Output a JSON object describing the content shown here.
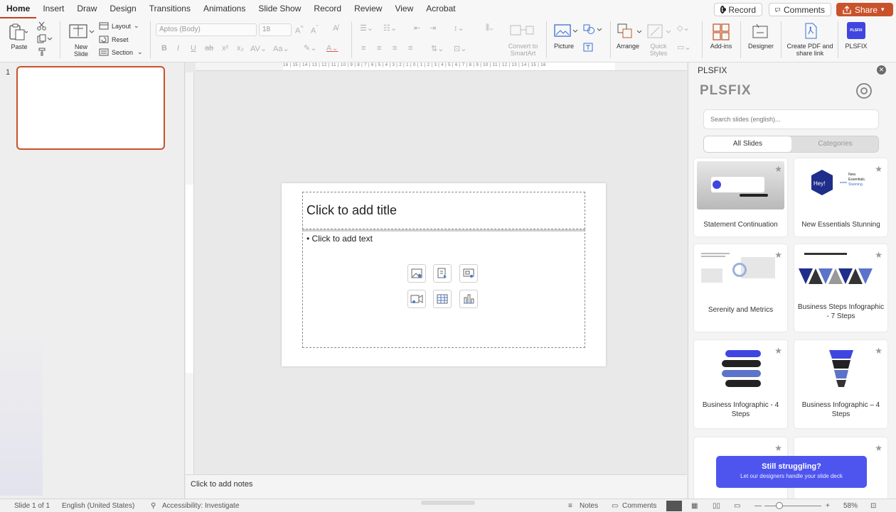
{
  "tabs": [
    "Home",
    "Insert",
    "Draw",
    "Design",
    "Transitions",
    "Animations",
    "Slide Show",
    "Record",
    "Review",
    "View",
    "Acrobat"
  ],
  "active_tab": "Home",
  "top_buttons": {
    "record": "Record",
    "comments": "Comments",
    "share": "Share"
  },
  "ribbon": {
    "paste": "Paste",
    "new_slide": "New Slide",
    "layout": "Layout",
    "reset": "Reset",
    "section": "Section",
    "font_name": "Aptos (Body)",
    "font_size": "18",
    "convert_smartart": "Convert to SmartArt",
    "picture": "Picture",
    "arrange": "Arrange",
    "quick_styles": "Quick Styles",
    "addins": "Add-ins",
    "designer": "Designer",
    "create_pdf": "Create PDF and share link",
    "plsfix": "PLSFIX",
    "plsfix_badge": "PLSFIX"
  },
  "thumbs": {
    "slide_number": "1"
  },
  "ruler": {
    "marks": "16 | 15 | 14 | 13 | 12 | 11 | 10 | 9 | 8 | 7 | 6 | 5 | 4 | 3 | 2 | 1 | 0 | 1 | 2 | 3 | 4 | 5 | 6 | 7 | 8 | 9 | 10 | 11 | 12 | 13 | 14 | 15 | 16"
  },
  "slide": {
    "title_placeholder": "Click to add title",
    "body_placeholder": "• Click to add text"
  },
  "notes": {
    "placeholder": "Click to add notes"
  },
  "pane": {
    "title": "PLSFIX",
    "logo": "PLSFIX",
    "search_placeholder": "Search slides (english)...",
    "segments": [
      "All Slides",
      "Categories"
    ],
    "cards": [
      {
        "label": "Statement Continuation"
      },
      {
        "label": "New Essentials Stunning"
      },
      {
        "label": "Serenity and Metrics"
      },
      {
        "label": "Business Steps Infographic - 7 Steps"
      },
      {
        "label": "Business Infographic - 4 Steps"
      },
      {
        "label": "Business Infographic – 4 Steps"
      }
    ],
    "cta_title": "Still struggling?",
    "cta_subtitle": "Let our designers handle your slide deck"
  },
  "status": {
    "slide_info": "Slide 1 of 1",
    "language": "English (United States)",
    "accessibility": "Accessibility: Investigate",
    "notes": "Notes",
    "comments": "Comments",
    "zoom": "58%",
    "zoom_level": 0.58
  },
  "colors": {
    "accent": "#c43e1c",
    "share": "#c9522b",
    "cta": "#4e55ef",
    "plsfix_badge": "#3f46e0"
  }
}
